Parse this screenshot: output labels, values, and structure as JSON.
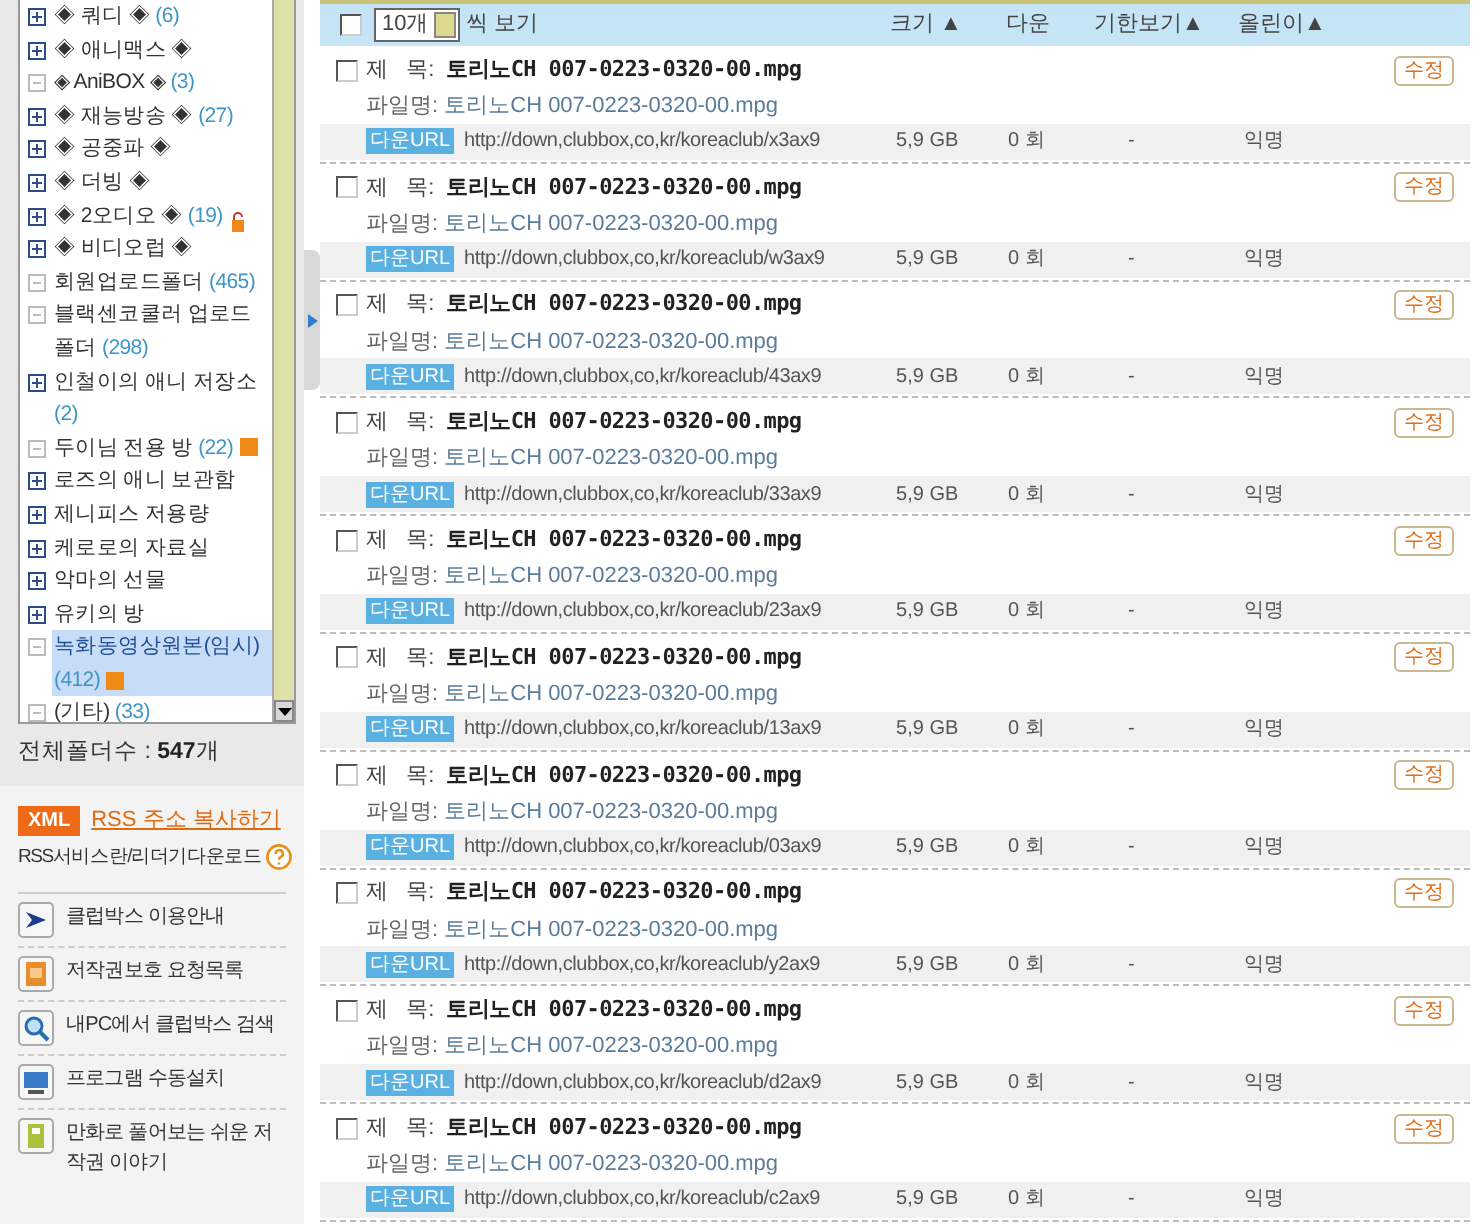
{
  "folder_tree": {
    "items": [
      {
        "label": "◈ 쿼디 ◈",
        "count": "(6)",
        "kind": "plus",
        "selected": false
      },
      {
        "label": "◈ 애니맥스 ◈",
        "kind": "plus",
        "selected": false
      },
      {
        "label": "◈ AniBOX ◈",
        "count": "(3)",
        "kind": "leaf",
        "selected": false
      },
      {
        "label": "◈ 재능방송 ◈",
        "count": "(27)",
        "kind": "plus",
        "selected": false
      },
      {
        "label": "◈ 공중파 ◈",
        "kind": "plus",
        "selected": false
      },
      {
        "label": "◈ 더빙 ◈",
        "kind": "plus",
        "selected": false
      },
      {
        "label": "◈ 2오디오 ◈",
        "count": "(19)",
        "kind": "plus",
        "locked": true,
        "selected": false
      },
      {
        "label": "◈ 비디오럽 ◈",
        "kind": "plus",
        "selected": false
      },
      {
        "label": "회원업로드폴더",
        "count": "(465)",
        "kind": "leaf",
        "selected": false
      },
      {
        "label": "블랙센코쿨러 업로드 폴더",
        "count": "(298)",
        "kind": "leaf",
        "selected": false
      },
      {
        "label": "인철이의 애니 저장소",
        "count": "(2)",
        "kind": "plus",
        "selected": false
      },
      {
        "label": "두이님 전용 방",
        "count": "(22)",
        "kind": "leaf",
        "new": true,
        "selected": false
      },
      {
        "label": "로즈의 애니 보관함",
        "kind": "plus",
        "selected": false
      },
      {
        "label": "제니피스 저용량",
        "kind": "plus",
        "selected": false
      },
      {
        "label": "케로로의 자료실",
        "kind": "plus",
        "selected": false
      },
      {
        "label": "악마의 선물",
        "kind": "plus",
        "selected": false
      },
      {
        "label": "유키의 방",
        "kind": "plus",
        "selected": false
      },
      {
        "label": "녹화동영상원본(임시)",
        "count": "(412)",
        "kind": "leaf",
        "new": true,
        "selected": true
      },
      {
        "label": "(기타)",
        "count": "(33)",
        "kind": "leaf",
        "selected": false
      }
    ]
  },
  "folder_total": {
    "label": "전체폴더수 : ",
    "value": "547",
    "unit": "개"
  },
  "rss": {
    "badge": "XML",
    "link": "RSS 주소 복사하기",
    "help": "RSS서비스란/리더기다운로드"
  },
  "side_links": [
    {
      "label": "클럽박스 이용안내",
      "kind": "guide"
    },
    {
      "label": "저작권보호 요청목록",
      "kind": "list"
    },
    {
      "label": "내PC에서 클럽박스 검색",
      "kind": "search"
    },
    {
      "label": "프로그램 수동설치",
      "kind": "install"
    },
    {
      "label": "만화로 풀어보는 쉬운 저작권 이야기",
      "kind": "comic"
    }
  ],
  "list_header": {
    "checked": false,
    "page_size": "10개",
    "page_size_suffix": "씩 보기",
    "columns": [
      "크기 ▲",
      "다운",
      "기한보기▲",
      "올린이▲"
    ]
  },
  "files": [
    {
      "checked": false,
      "title_label": "제   목:",
      "title": "토리노CH 007-0223-0320-00.mpg",
      "filename_label": "파일명:",
      "filename": "토리노CH 007-0223-0320-00.mpg",
      "edit": "수정",
      "url_badge": "다운URL",
      "url": "http://down,clubbox,co,kr/koreaclub/x3ax9",
      "size": "5,9 GB",
      "downloads": "0 회",
      "expiry": "-",
      "uploader": "익명"
    },
    {
      "checked": false,
      "title_label": "제   목:",
      "title": "토리노CH 007-0223-0320-00.mpg",
      "filename_label": "파일명:",
      "filename": "토리노CH 007-0223-0320-00.mpg",
      "edit": "수정",
      "url_badge": "다운URL",
      "url": "http://down,clubbox,co,kr/koreaclub/w3ax9",
      "size": "5,9 GB",
      "downloads": "0 회",
      "expiry": "-",
      "uploader": "익명"
    },
    {
      "checked": false,
      "title_label": "제   목:",
      "title": "토리노CH 007-0223-0320-00.mpg",
      "filename_label": "파일명:",
      "filename": "토리노CH 007-0223-0320-00.mpg",
      "edit": "수정",
      "url_badge": "다운URL",
      "url": "http://down,clubbox,co,kr/koreaclub/43ax9",
      "size": "5,9 GB",
      "downloads": "0 회",
      "expiry": "-",
      "uploader": "익명"
    },
    {
      "checked": false,
      "title_label": "제   목:",
      "title": "토리노CH 007-0223-0320-00.mpg",
      "filename_label": "파일명:",
      "filename": "토리노CH 007-0223-0320-00.mpg",
      "edit": "수정",
      "url_badge": "다운URL",
      "url": "http://down,clubbox,co,kr/koreaclub/33ax9",
      "size": "5,9 GB",
      "downloads": "0 회",
      "expiry": "-",
      "uploader": "익명"
    },
    {
      "checked": false,
      "title_label": "제   목:",
      "title": "토리노CH 007-0223-0320-00.mpg",
      "filename_label": "파일명:",
      "filename": "토리노CH 007-0223-0320-00.mpg",
      "edit": "수정",
      "url_badge": "다운URL",
      "url": "http://down,clubbox,co,kr/koreaclub/23ax9",
      "size": "5,9 GB",
      "downloads": "0 회",
      "expiry": "-",
      "uploader": "익명"
    },
    {
      "checked": false,
      "title_label": "제   목:",
      "title": "토리노CH 007-0223-0320-00.mpg",
      "filename_label": "파일명:",
      "filename": "토리노CH 007-0223-0320-00.mpg",
      "edit": "수정",
      "url_badge": "다운URL",
      "url": "http://down,clubbox,co,kr/koreaclub/13ax9",
      "size": "5,9 GB",
      "downloads": "0 회",
      "expiry": "-",
      "uploader": "익명"
    },
    {
      "checked": false,
      "title_label": "제   목:",
      "title": "토리노CH 007-0223-0320-00.mpg",
      "filename_label": "파일명:",
      "filename": "토리노CH 007-0223-0320-00.mpg",
      "edit": "수정",
      "url_badge": "다운URL",
      "url": "http://down,clubbox,co,kr/koreaclub/03ax9",
      "size": "5,9 GB",
      "downloads": "0 회",
      "expiry": "-",
      "uploader": "익명"
    },
    {
      "checked": false,
      "title_label": "제   목:",
      "title": "토리노CH 007-0223-0320-00.mpg",
      "filename_label": "파일명:",
      "filename": "토리노CH 007-0223-0320-00.mpg",
      "edit": "수정",
      "url_badge": "다운URL",
      "url": "http://down,clubbox,co,kr/koreaclub/y2ax9",
      "size": "5,9 GB",
      "downloads": "0 회",
      "expiry": "-",
      "uploader": "익명"
    },
    {
      "checked": false,
      "title_label": "제   목:",
      "title": "토리노CH 007-0223-0320-00.mpg",
      "filename_label": "파일명:",
      "filename": "토리노CH 007-0223-0320-00.mpg",
      "edit": "수정",
      "url_badge": "다운URL",
      "url": "http://down,clubbox,co,kr/koreaclub/d2ax9",
      "size": "5,9 GB",
      "downloads": "0 회",
      "expiry": "-",
      "uploader": "익명"
    },
    {
      "checked": false,
      "title_label": "제   목:",
      "title": "토리노CH 007-0223-0320-00.mpg",
      "filename_label": "파일명:",
      "filename": "토리노CH 007-0223-0320-00.mpg",
      "edit": "수정",
      "url_badge": "다운URL",
      "url": "http://down,clubbox,co,kr/koreaclub/c2ax9",
      "size": "5,9 GB",
      "downloads": "0 회",
      "expiry": "-",
      "uploader": "익명"
    }
  ]
}
